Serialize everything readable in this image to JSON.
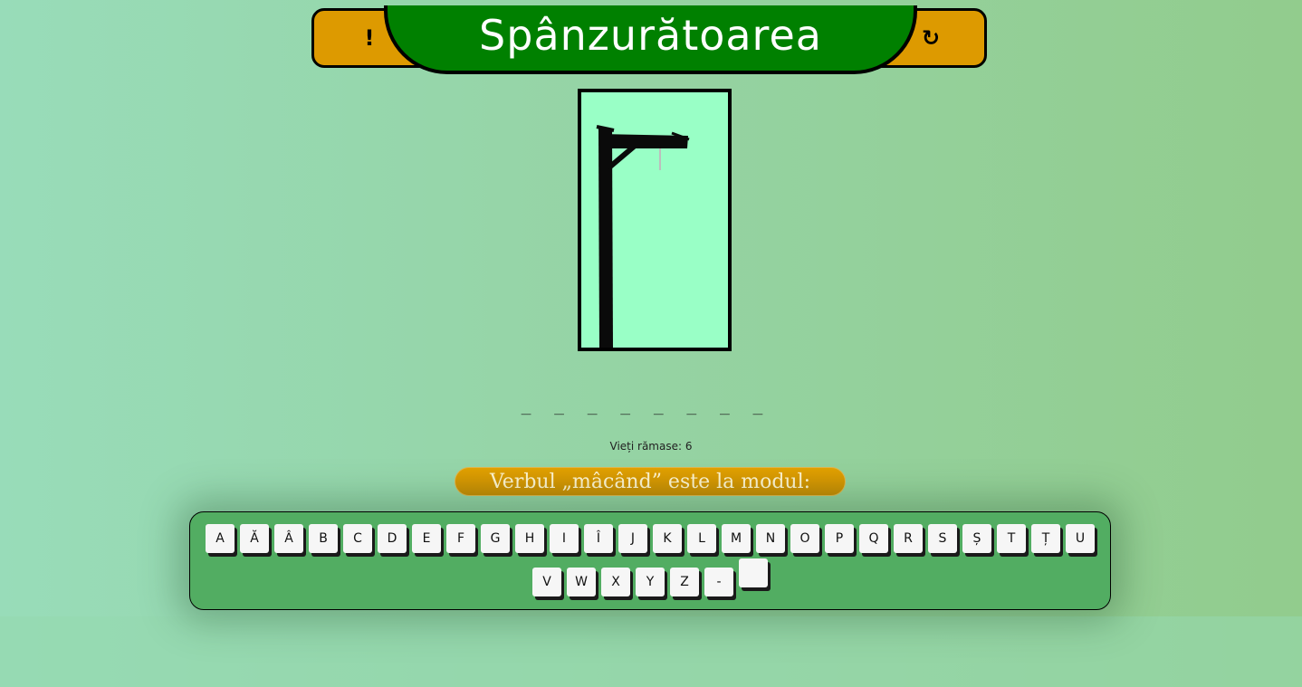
{
  "header": {
    "title": "Spânzurătoarea",
    "info_button": "!",
    "reset_icon": "refresh-icon",
    "reset_glyph": "↻"
  },
  "colors": {
    "header_bar": "#dd9a00",
    "title_banner": "#008000",
    "gallows_bg": "#99ffc6",
    "keyboard_bg": "#52ad62",
    "hint_bg": "#d59600"
  },
  "game": {
    "word_slots": [
      "_",
      "_",
      "_",
      "_",
      "_",
      "_",
      "_",
      "_"
    ],
    "lives_text": "Vieți rămase: 6",
    "lives_remaining": 6,
    "hint": "Verbul „mâcând” este la modul:"
  },
  "keyboard": {
    "row1": [
      "A",
      "Ă",
      "Â",
      "B",
      "C",
      "D",
      "E",
      "F",
      "G",
      "H",
      "I",
      "Î",
      "J",
      "K",
      "L",
      "M",
      "N",
      "O",
      "P",
      "Q",
      "R",
      "S",
      "Ș",
      "T",
      "Ț",
      "U"
    ],
    "row2": [
      "V",
      "W",
      "X",
      "Y",
      "Z",
      "-",
      ""
    ]
  }
}
